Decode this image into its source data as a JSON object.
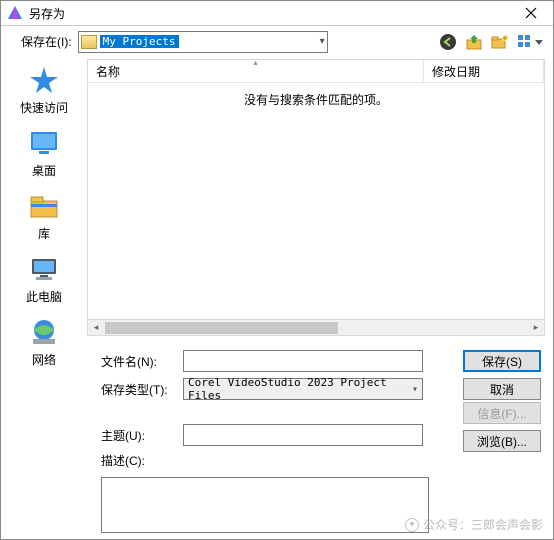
{
  "titlebar": {
    "title": "另存为"
  },
  "toolbar": {
    "save_in_label": "保存在(I):",
    "save_in_value": "My Projects",
    "icons": [
      "back-icon",
      "up-icon",
      "new-folder-icon",
      "view-menu-icon"
    ]
  },
  "listview": {
    "col_name": "名称",
    "col_date": "修改日期",
    "empty_text": "没有与搜索条件匹配的项。"
  },
  "sidebar": {
    "items": [
      {
        "label": "快速访问",
        "icon": "quick-access-icon"
      },
      {
        "label": "桌面",
        "icon": "desktop-icon"
      },
      {
        "label": "库",
        "icon": "libraries-icon"
      },
      {
        "label": "此电脑",
        "icon": "this-pc-icon"
      },
      {
        "label": "网络",
        "icon": "network-icon"
      }
    ]
  },
  "form": {
    "filename_label": "文件名(N):",
    "filename_value": "",
    "filetype_label": "保存类型(T):",
    "filetype_value": "Corel VideoStudio 2023 Project Files",
    "subject_label": "主题(U):",
    "subject_value": "",
    "desc_label": "描述(C):",
    "desc_value": ""
  },
  "buttons": {
    "save": "保存(S)",
    "cancel": "取消",
    "info": "信息(F)...",
    "browse": "浏览(B)..."
  },
  "watermark": "公众号：三郎会声会影"
}
